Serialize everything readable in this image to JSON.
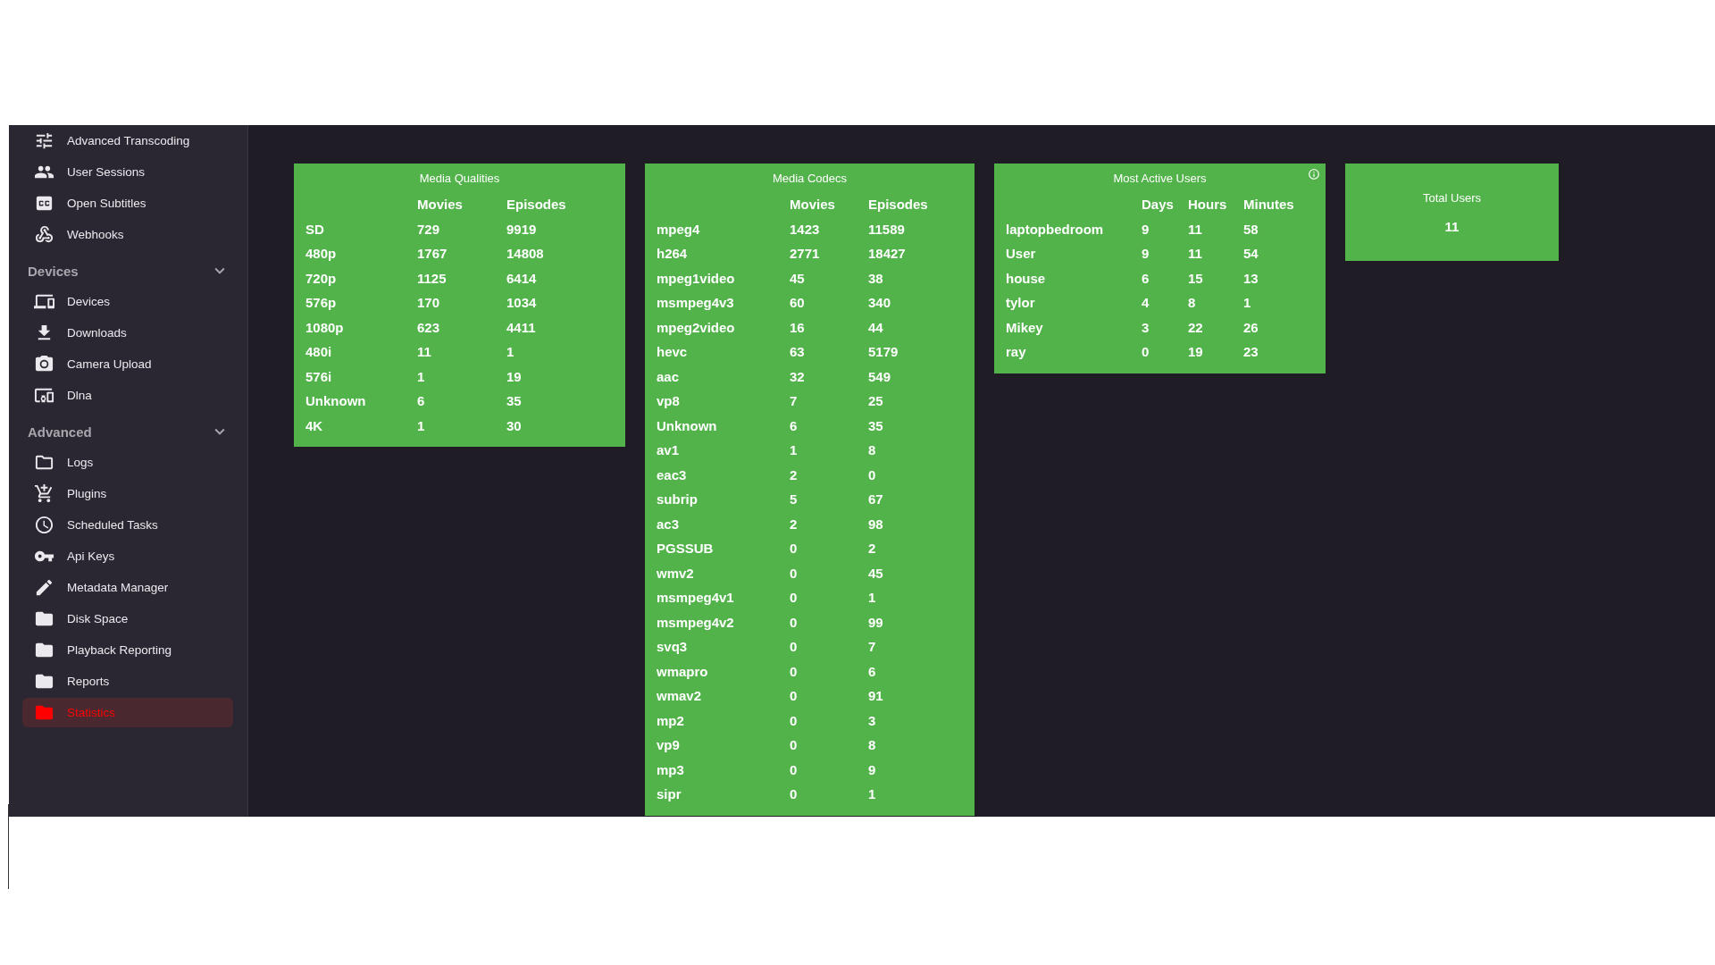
{
  "sidebar": {
    "sections": [
      {
        "items": [
          {
            "label": "Advanced Transcoding",
            "selected": false
          },
          {
            "label": "User Sessions",
            "selected": false
          },
          {
            "label": "Open Subtitles",
            "selected": false
          },
          {
            "label": "Webhooks",
            "selected": false
          }
        ]
      },
      {
        "title": "Devices",
        "expanded": true,
        "items": [
          {
            "label": "Devices",
            "selected": false
          },
          {
            "label": "Downloads",
            "selected": false
          },
          {
            "label": "Camera Upload",
            "selected": false
          },
          {
            "label": "Dlna",
            "selected": false
          }
        ]
      },
      {
        "title": "Advanced",
        "expanded": true,
        "items": [
          {
            "label": "Logs",
            "selected": false
          },
          {
            "label": "Plugins",
            "selected": false
          },
          {
            "label": "Scheduled Tasks",
            "selected": false
          },
          {
            "label": "Api Keys",
            "selected": false
          },
          {
            "label": "Metadata Manager",
            "selected": false
          },
          {
            "label": "Disk Space",
            "selected": false
          },
          {
            "label": "Playback Reporting",
            "selected": false
          },
          {
            "label": "Reports",
            "selected": false
          },
          {
            "label": "Statistics",
            "selected": true
          }
        ]
      }
    ]
  },
  "cards": [
    {
      "kind": "table",
      "title": "Media Qualities",
      "columns": [
        "",
        "Movies",
        "Episodes"
      ],
      "rows": [
        [
          "SD",
          "729",
          "9919"
        ],
        [
          "480p",
          "1767",
          "14808"
        ],
        [
          "720p",
          "1125",
          "6414"
        ],
        [
          "576p",
          "170",
          "1034"
        ],
        [
          "1080p",
          "623",
          "4411"
        ],
        [
          "480i",
          "11",
          "1"
        ],
        [
          "576i",
          "1",
          "19"
        ],
        [
          "Unknown",
          "6",
          "35"
        ],
        [
          "4K",
          "1",
          "30"
        ]
      ]
    },
    {
      "kind": "table",
      "title": "Media Codecs",
      "columns": [
        "",
        "Movies",
        "Episodes"
      ],
      "rows": [
        [
          "mpeg4",
          "1423",
          "11589"
        ],
        [
          "h264",
          "2771",
          "18427"
        ],
        [
          "mpeg1video",
          "45",
          "38"
        ],
        [
          "msmpeg4v3",
          "60",
          "340"
        ],
        [
          "mpeg2video",
          "16",
          "44"
        ],
        [
          "hevc",
          "63",
          "5179"
        ],
        [
          "aac",
          "32",
          "549"
        ],
        [
          "vp8",
          "7",
          "25"
        ],
        [
          "Unknown",
          "6",
          "35"
        ],
        [
          "av1",
          "1",
          "8"
        ],
        [
          "eac3",
          "2",
          "0"
        ],
        [
          "subrip",
          "5",
          "67"
        ],
        [
          "ac3",
          "2",
          "98"
        ],
        [
          "PGSSUB",
          "0",
          "2"
        ],
        [
          "wmv2",
          "0",
          "45"
        ],
        [
          "msmpeg4v1",
          "0",
          "1"
        ],
        [
          "msmpeg4v2",
          "0",
          "99"
        ],
        [
          "svq3",
          "0",
          "7"
        ],
        [
          "wmapro",
          "0",
          "6"
        ],
        [
          "wmav2",
          "0",
          "91"
        ],
        [
          "mp2",
          "0",
          "3"
        ],
        [
          "vp9",
          "0",
          "8"
        ],
        [
          "mp3",
          "0",
          "9"
        ],
        [
          "sipr",
          "0",
          "1"
        ]
      ]
    },
    {
      "kind": "table",
      "title": "Most Active Users",
      "info_button": true,
      "columns": [
        "",
        "Days",
        "Hours",
        "Minutes"
      ],
      "rows": [
        [
          "laptopbedroom",
          "9",
          "11",
          "58"
        ],
        [
          "User",
          "9",
          "11",
          "54"
        ],
        [
          "house",
          "6",
          "15",
          "13"
        ],
        [
          "tylor",
          "4",
          "8",
          "1"
        ],
        [
          "Mikey",
          "3",
          "22",
          "26"
        ],
        [
          "ray",
          "0",
          "19",
          "23"
        ]
      ]
    },
    {
      "kind": "stat",
      "title": "Total Users",
      "value": "11"
    }
  ]
}
